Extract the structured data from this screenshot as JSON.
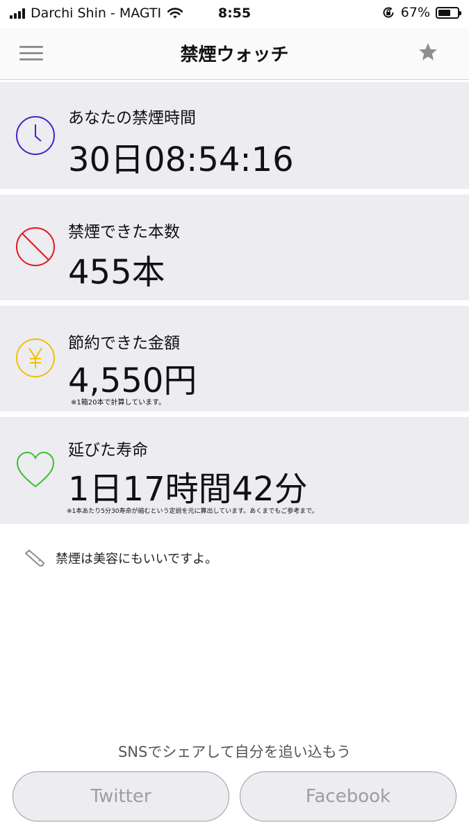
{
  "status_bar": {
    "carrier": "Darchi Shin - MAGTI",
    "time": "8:55",
    "battery_percent": "67%",
    "battery_level": 0.67
  },
  "nav": {
    "title": "禁煙ウォッチ",
    "left_icon": "hamburger-menu-icon",
    "right_icon": "star-icon"
  },
  "cards": [
    {
      "icon": "clock-icon",
      "icon_color": "#4b1fc7",
      "label": "あなたの禁煙時間",
      "value": "30日08:54:16",
      "note": ""
    },
    {
      "icon": "prohibited-icon",
      "icon_color": "#e8141e",
      "label": "禁煙できた本数",
      "value": "455本",
      "note": ""
    },
    {
      "icon": "yen-icon",
      "icon_color": "#f2c100",
      "label": "節約できた金額",
      "value": "4,550円",
      "note": "※1箱20本で計算しています。"
    },
    {
      "icon": "heart-icon",
      "icon_color": "#3cbf2a",
      "label": "延びた寿命",
      "value": "1日17時間42分",
      "note": "※1本あたり5分30寿命が縮むという定説を元に算出しています。あくまでもご参考まで。"
    }
  ],
  "tip": {
    "icon": "pencil-icon",
    "text": "禁煙は美容にもいいですよ。"
  },
  "share": {
    "text": "SNSでシェアして自分を追い込もう",
    "twitter_label": "Twitter",
    "facebook_label": "Facebook"
  }
}
